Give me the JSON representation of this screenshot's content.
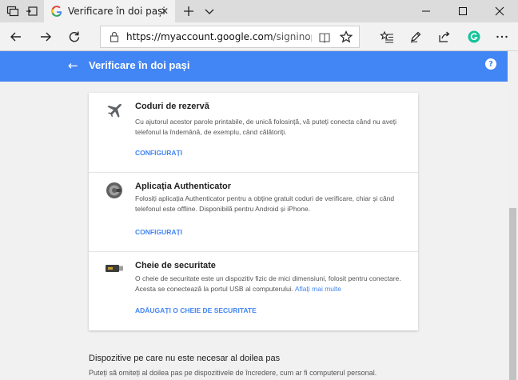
{
  "browser": {
    "tab_title": "Verificare în doi pași",
    "tab_close": "✕",
    "address": {
      "host": "https://myaccount.google.com",
      "path": "/signinoptions/two"
    }
  },
  "header": {
    "title": "Verificare în doi pași",
    "back": "←",
    "help": "?"
  },
  "sections": [
    {
      "title": "Coduri de rezervă",
      "desc": "Cu ajutorul acestor parole printabile, de unică folosință, vă puteți conecta când nu aveți telefonul la îndemână, de exemplu, când călătoriți.",
      "link": "CONFIGURAȚI"
    },
    {
      "title": "Aplicația Authenticator",
      "desc": "Folosiți aplicația Authenticator pentru a obține gratuit coduri de verificare, chiar și când telefonul este offline. Disponibilă pentru Android și iPhone.",
      "link": "CONFIGURAȚI"
    },
    {
      "title": "Cheie de securitate",
      "desc": "O cheie de securitate este un dispozitiv fizic de mici dimensiuni, folosit pentru conectare. Acesta se conectează la portul USB al computerului.",
      "desc_link": "Aflați mai multe",
      "link": "ADĂUGAȚI O CHEIE DE SECURITATE"
    }
  ],
  "bottom": {
    "title": "Dispozitive pe care nu este necesar al doilea pas",
    "desc": "Puteți să omiteți al doilea pas pe dispozitivele de încredere, cum ar fi computerul personal."
  },
  "colors": {
    "accent": "#4285f4",
    "text": "#212121",
    "muted": "#555555"
  },
  "icons": {
    "back": "arrow-left-icon",
    "forward": "arrow-right-icon",
    "refresh": "refresh-icon",
    "lock": "lock-icon",
    "reading": "reading-view-icon",
    "favorite": "star-icon",
    "hub": "favorites-hub-icon",
    "notes": "pen-icon",
    "share": "share-icon",
    "grammarly": "grammarly-icon",
    "more": "more-icon",
    "backup": "airplane-icon",
    "authenticator": "authenticator-icon",
    "security_key": "usb-key-icon"
  }
}
